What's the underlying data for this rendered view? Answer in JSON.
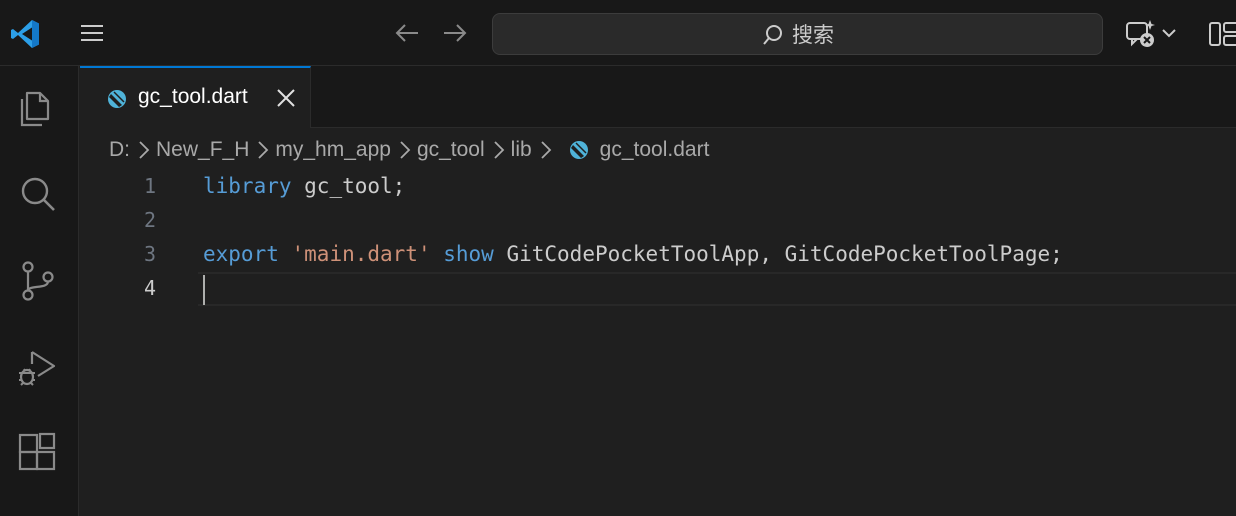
{
  "titlebar": {
    "search_placeholder": "搜索"
  },
  "activity_bar": {
    "icons": [
      "explorer-icon",
      "search-icon",
      "source-control-icon",
      "run-debug-icon",
      "extensions-icon"
    ]
  },
  "tabs": [
    {
      "label": "gc_tool.dart",
      "icon": "dart-file-icon",
      "active": true
    }
  ],
  "breadcrumb": {
    "items": [
      "D:",
      "New_F_H",
      "my_hm_app",
      "gc_tool",
      "lib",
      "gc_tool.dart"
    ]
  },
  "editor": {
    "line_numbers": [
      "1",
      "2",
      "3",
      "4"
    ],
    "active_line": "4",
    "line1": {
      "keyword": "library",
      "rest": " gc_tool;"
    },
    "line3": {
      "keyword_export": "export",
      "string": "'main.dart'",
      "keyword_show": "show",
      "rest": " GitCodePocketToolApp, GitCodePocketToolPage;"
    }
  },
  "colors": {
    "accent": "#0078d4",
    "keyword": "#569cd6",
    "string": "#ce9178",
    "identifier": "#cccccc",
    "background": "#1f1f1f",
    "chrome": "#181818"
  }
}
